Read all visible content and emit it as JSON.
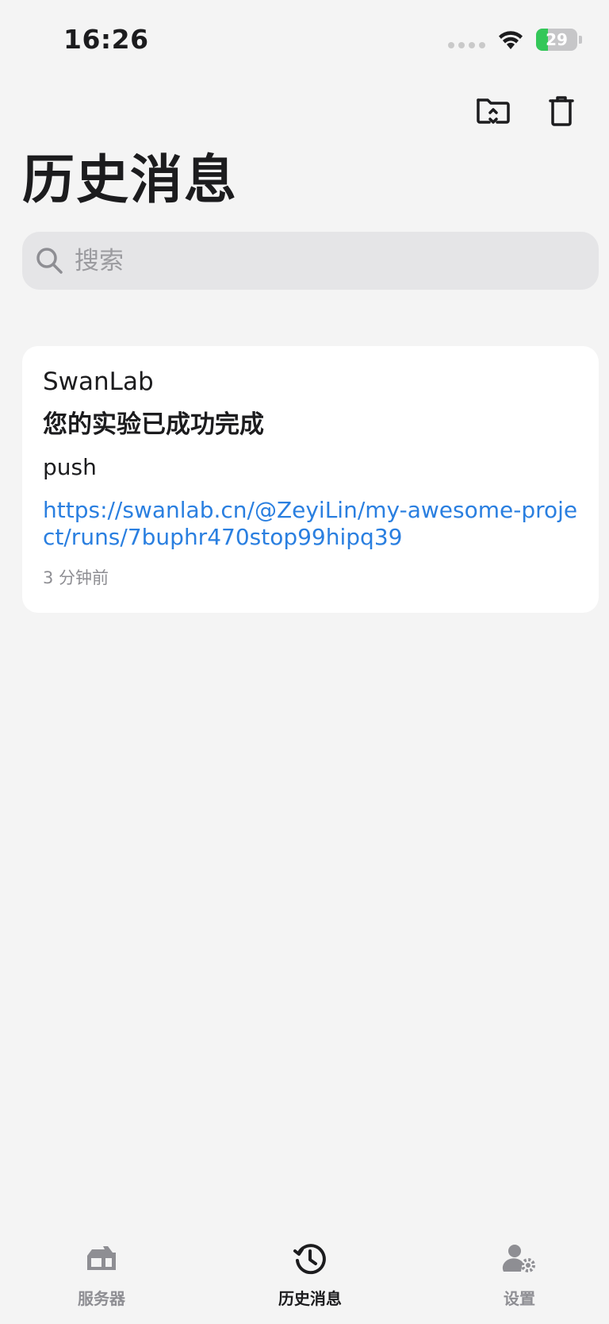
{
  "status_bar": {
    "time": "16:26",
    "battery_level": "29",
    "battery_percent": 29
  },
  "toolbar": {
    "folder_icon": "folder-badge-icon",
    "trash_icon": "trash-icon"
  },
  "page": {
    "title": "历史消息"
  },
  "search": {
    "placeholder": "搜索",
    "value": ""
  },
  "messages": [
    {
      "group": "SwanLab",
      "title": "您的实验已成功完成",
      "body": "push",
      "url": "https://swanlab.cn/@ZeyiLin/my-awesome-project/runs/7buphr470stop99hipq39",
      "time": "3 分钟前"
    }
  ],
  "tabs": [
    {
      "label": "服务器",
      "icon": "server-icon",
      "active": false
    },
    {
      "label": "历史消息",
      "icon": "history-icon",
      "active": true
    },
    {
      "label": "设置",
      "icon": "user-settings-icon",
      "active": false
    }
  ],
  "colors": {
    "background": "#f4f4f4",
    "card": "#ffffff",
    "link": "#2a7fe0",
    "battery_green": "#34c759",
    "secondary_text": "#8e8e93"
  }
}
